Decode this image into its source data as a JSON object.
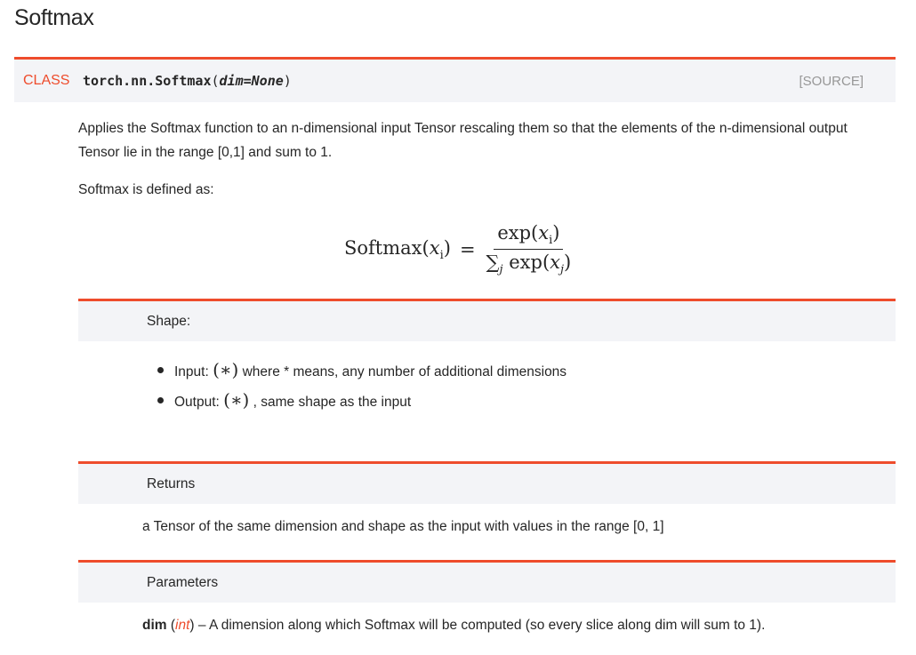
{
  "page": {
    "title": "Softmax"
  },
  "signature": {
    "class_keyword": "CLASS",
    "name": "torch.nn.Softmax",
    "open_paren": "(",
    "param": "dim=None",
    "close_paren": ")",
    "source_label": "[SOURCE]"
  },
  "description": {
    "paragraph1": "Applies the Softmax function to an n-dimensional input Tensor rescaling them so that the elements of the n-dimensional output Tensor lie in the range [0,1] and sum to 1.",
    "paragraph2": "Softmax is defined as:"
  },
  "formula": {
    "lhs_func": "Softmax(",
    "lhs_var": "x",
    "lhs_sub": "i",
    "lhs_close": ")",
    "equals": "=",
    "numerator_func": "exp(",
    "numerator_var": "x",
    "numerator_sub": "i",
    "numerator_close": ")",
    "denominator_sum": "∑",
    "denominator_sum_sub": "j",
    "denominator_func": " exp(",
    "denominator_var": "x",
    "denominator_sub": "j",
    "denominator_close": ")"
  },
  "shape": {
    "header": "Shape:",
    "items": [
      {
        "label": "Input: ",
        "math": "(∗)",
        "text": " where * means, any number of additional dimensions"
      },
      {
        "label": "Output: ",
        "math": "(∗)",
        "text": " , same shape as the input"
      }
    ]
  },
  "returns": {
    "header": "Returns",
    "text": "a Tensor of the same dimension and shape as the input with values in the range [0, 1]"
  },
  "parameters": {
    "header": "Parameters",
    "items": [
      {
        "name": "dim",
        "open": " (",
        "type": "int",
        "close": ")",
        "description": " – A dimension along which Softmax will be computed (so every slice along dim will sum to 1)."
      }
    ]
  },
  "colors": {
    "accent": "#ee4c2c",
    "header_bg": "#f3f4f7",
    "text": "#262626",
    "muted": "#979797"
  }
}
